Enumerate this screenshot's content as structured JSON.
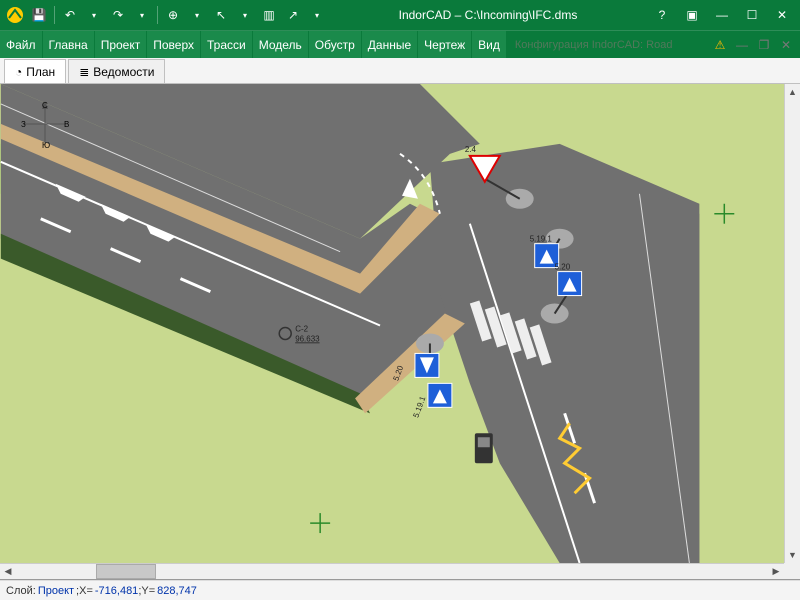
{
  "title": "IndorCAD – C:\\Incoming\\IFC.dms",
  "qat": {
    "save": "💾",
    "undo": "↶",
    "redo": "↷",
    "tool1": "⊕",
    "tool2": "▦",
    "cursor": "↖",
    "tool3": "▥",
    "pointer": "↗",
    "more": "▾"
  },
  "win": {
    "help": "?",
    "ribbon": "▣",
    "min": "—",
    "max": "☐",
    "close": "✕"
  },
  "menu": [
    "Файл",
    "Главна",
    "Проект",
    "Поверх",
    "Трасси",
    "Модель",
    "Обустр",
    "Данные",
    "Чертеж",
    "Вид"
  ],
  "config_label": "Конфигурация IndorCAD: Road",
  "tabs": [
    {
      "icon": "◔",
      "label": "План"
    },
    {
      "icon": "≣",
      "label": "Ведомости"
    }
  ],
  "compass": {
    "n": "С",
    "s": "Ю",
    "e": "В",
    "w": "З"
  },
  "well": {
    "label_line1": "С-2",
    "label_line2": "96.633"
  },
  "signs": {
    "yield_label": "2.4",
    "crosswalk_r1": "5.19.1",
    "crosswalk_r2": "5.20",
    "crosswalk_l1": "5.20",
    "crosswalk_l2": "5.19.1"
  },
  "status": {
    "layer_label": "Слой:",
    "layer_value": "Проект",
    "x_label": "X=",
    "x_value": "-716,481",
    "y_label": "Y=",
    "y_value": "828,747"
  }
}
